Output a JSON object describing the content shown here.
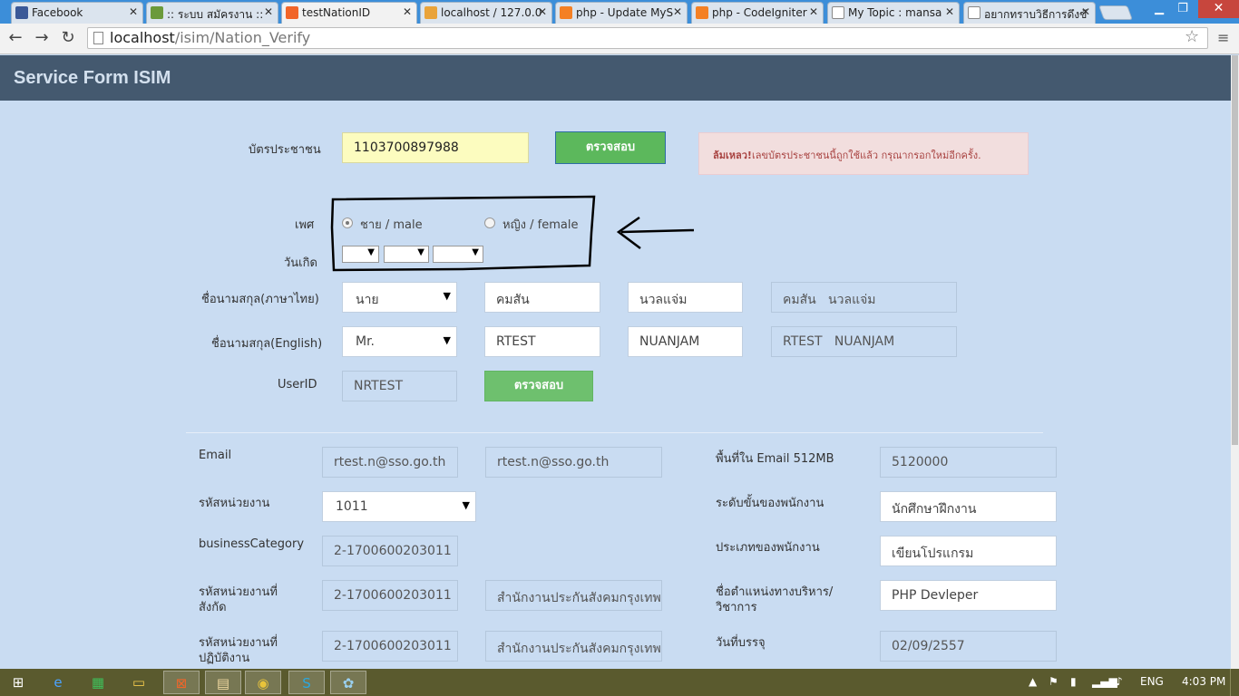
{
  "browser": {
    "tabs": [
      {
        "label": "Facebook",
        "icon": "facebook-icon",
        "color": "#3b5998"
      },
      {
        "label": ":: ระบบ สมัครงาน ::",
        "icon": "site-icon",
        "color": "#6b9a3a"
      },
      {
        "label": "testNationID",
        "icon": "xampp-icon",
        "color": "#f16529",
        "active": true
      },
      {
        "label": "localhost / 127.0.0",
        "icon": "phpmyadmin-icon",
        "color": "#e9a33a"
      },
      {
        "label": "php - Update MyS",
        "icon": "stackoverflow-icon",
        "color": "#f48024"
      },
      {
        "label": "php - CodeIgniter",
        "icon": "stackoverflow-icon",
        "color": "#f48024"
      },
      {
        "label": "My Topic : mansa",
        "icon": "page-icon",
        "color": "#ffffff"
      },
      {
        "label": "อยากทราบวิธีการดึงข้",
        "icon": "page-icon",
        "color": "#ffffff"
      }
    ],
    "url_host": "localhost",
    "url_path": "/isim/Nation_Verify"
  },
  "header": {
    "title": "Service Form ISIM"
  },
  "form": {
    "national_id": {
      "label": "บัตรประชาชน",
      "value": "1103700897988",
      "check_button": "ตรวจสอบ"
    },
    "alert": {
      "strong": "ล้มเหลว!",
      "message": "เลขบัตรประชาชนนี้ถูกใช้แล้ว กรุณากรอกใหม่อีกครั้ง."
    },
    "gender": {
      "label": "เพศ",
      "male": "ชาย / male",
      "female": "หญิง / female",
      "selected": "male"
    },
    "birthdate": {
      "label": "วันเกิด"
    },
    "name_thai": {
      "label": "ชื่อนามสกุล(ภาษาไทย)",
      "prefix": "นาย",
      "first": "คมสัน",
      "last": "นวลแจ่ม",
      "full": "คมสัน   นวลแจ่ม"
    },
    "name_english": {
      "label": "ชื่อนามสกุล(English)",
      "prefix": "Mr.",
      "first": "RTEST",
      "last": "NUANJAM",
      "full": "RTEST   NUANJAM"
    },
    "userid": {
      "label": "UserID",
      "value": "NRTEST",
      "check_button": "ตรวจสอบ"
    },
    "email": {
      "label": "Email",
      "value1": "rtest.n@sso.go.th",
      "value2": "rtest.n@sso.go.th"
    },
    "quota": {
      "label": "พื้นที่ใน Email 512MB",
      "value": "5120000"
    },
    "unit_code": {
      "label": "รหัสหน่วยงาน",
      "value": "1011"
    },
    "level": {
      "label": "ระดับขั้นของพนักงาน",
      "value": "นักศึกษาฝึกงาน"
    },
    "business_category": {
      "label": "businessCategory",
      "value": "2-1700600203011"
    },
    "employee_type": {
      "label": "ประเภทของพนักงาน",
      "value": "เขียนโปรแกรม"
    },
    "affiliation": {
      "label_line1": "รหัสหน่วยงานที่",
      "label_line2": "สังกัด",
      "code": "2-1700600203011",
      "name": "สำนักงานประกันสังคมกรุงเทพ"
    },
    "position": {
      "label_line1": "ชื่อตำแหน่งทางบริหาร/",
      "label_line2": "วิชาการ",
      "value": "PHP Devleper"
    },
    "workplace": {
      "label_line1": "รหัสหน่วยงานที่",
      "label_line2": "ปฏิบัติงาน",
      "code": "2-1700600203011",
      "name": "สำนักงานประกันสังคมกรุงเทพ"
    },
    "start_date": {
      "label": "วันที่บรรจุ",
      "value": "02/09/2557"
    }
  },
  "taskbar": {
    "language": "ENG",
    "time": "4:03 PM"
  },
  "colors": {
    "header_bg": "#44596f",
    "page_bg": "#c9dcf2",
    "button_green": "#5cb85c",
    "alert_bg": "#f2dede"
  }
}
